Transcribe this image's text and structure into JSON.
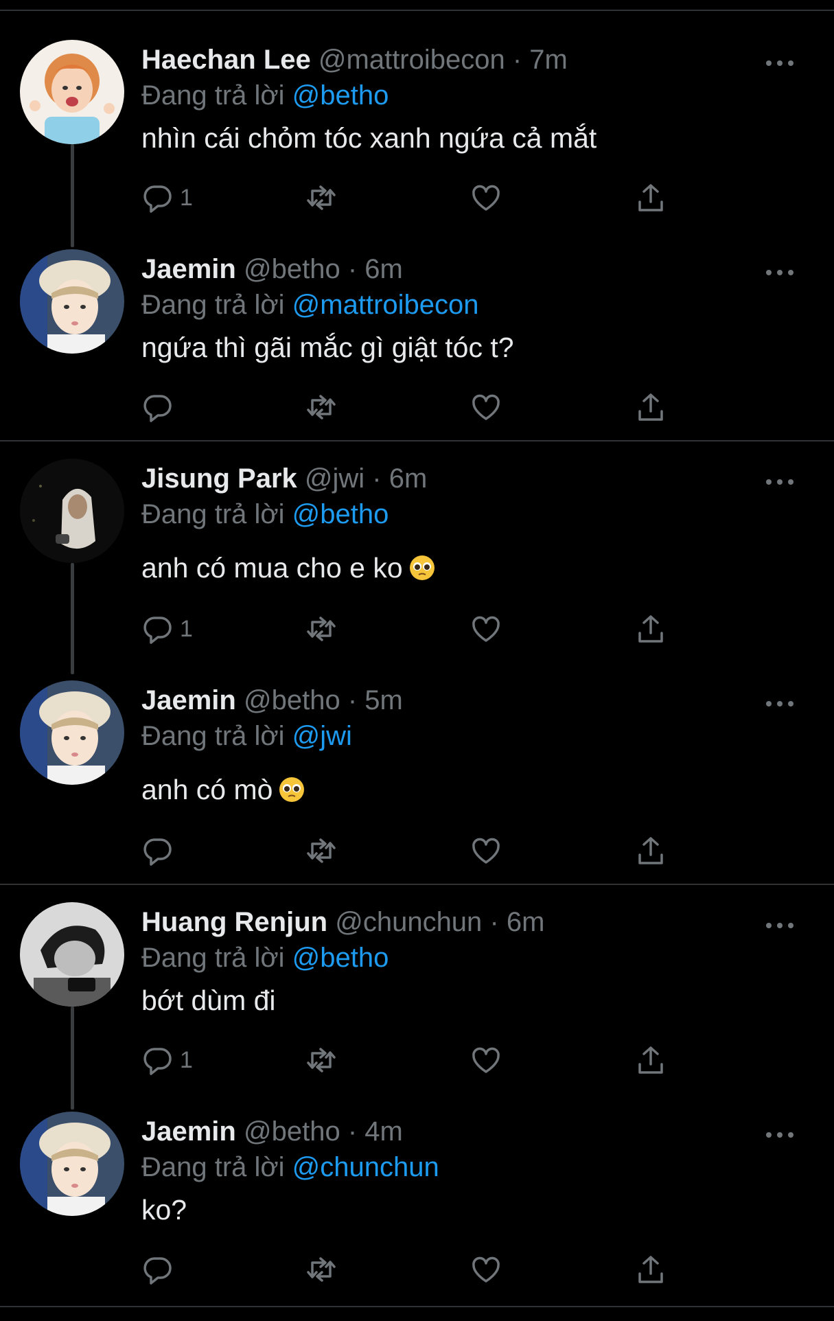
{
  "ui": {
    "replying_prefix": "Đang trả lời",
    "colors": {
      "background": "#000000",
      "accent": "#1d9bf0",
      "muted": "#71767b",
      "text": "#e7e9ea",
      "divider": "#2f3336"
    },
    "icons": [
      "reply-icon",
      "retweet-icon",
      "like-icon",
      "share-icon",
      "more-icon"
    ]
  },
  "tweets": [
    {
      "name": "Haechan Lee",
      "handle": "@mattroibecon",
      "time": "· 7m",
      "replying_to": "@betho",
      "text": "nhìn cái chỏm tóc xanh ngứa cả mắt",
      "reply_count": "1"
    },
    {
      "name": "Jaemin",
      "handle": "@betho",
      "time": "· 6m",
      "replying_to": "@mattroibecon",
      "text": "ngứa thì gãi mắc gì giật tóc t?",
      "reply_count": ""
    },
    {
      "name": "Jisung Park",
      "handle": "@jwi",
      "time": "· 6m",
      "replying_to": "@betho",
      "text": "anh có mua cho e ko",
      "reply_count": "1"
    },
    {
      "name": "Jaemin",
      "handle": "@betho",
      "time": "· 5m",
      "replying_to": "@jwi",
      "text": "anh có mò",
      "reply_count": ""
    },
    {
      "name": "Huang Renjun",
      "handle": "@chunchun",
      "time": "· 6m",
      "replying_to": "@betho",
      "text": "bớt dùm đi",
      "reply_count": "1"
    },
    {
      "name": "Jaemin",
      "handle": "@betho",
      "time": "· 4m",
      "replying_to": "@chunchun",
      "text": "ko?",
      "reply_count": ""
    }
  ]
}
